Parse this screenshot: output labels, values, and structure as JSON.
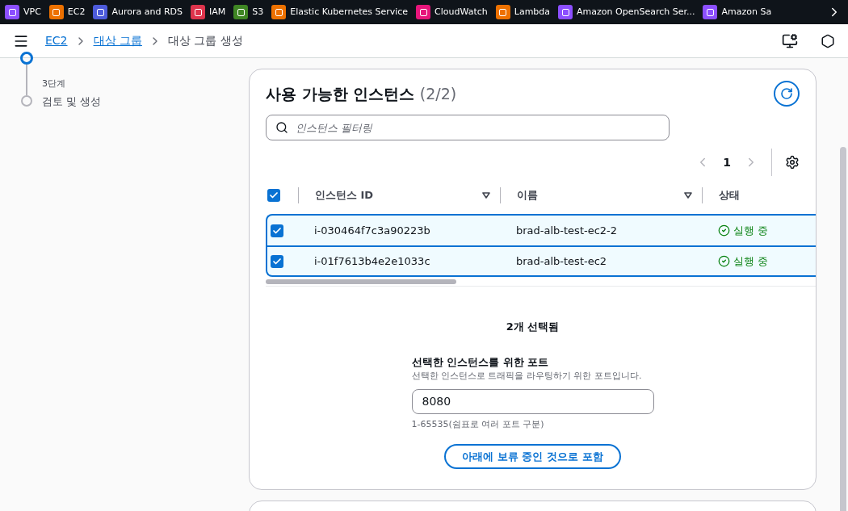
{
  "services": [
    {
      "label": "VPC",
      "color": "#8c4fff"
    },
    {
      "label": "EC2",
      "color": "#ed7100"
    },
    {
      "label": "Aurora and RDS",
      "color": "#4d5bdb"
    },
    {
      "label": "IAM",
      "color": "#dd344c"
    },
    {
      "label": "S3",
      "color": "#3f8624"
    },
    {
      "label": "Elastic Kubernetes Service",
      "color": "#ed7100"
    },
    {
      "label": "CloudWatch",
      "color": "#e7157b"
    },
    {
      "label": "Lambda",
      "color": "#ed7100"
    },
    {
      "label": "Amazon OpenSearch Ser...",
      "color": "#8c4fff"
    },
    {
      "label": "Amazon Sa",
      "color": "#8c4fff"
    }
  ],
  "breadcrumbs": [
    {
      "label": "EC2",
      "kind": "link"
    },
    {
      "label": "대상 그룹",
      "kind": "link"
    },
    {
      "label": "대상 그룹 생성",
      "kind": "current"
    }
  ],
  "steps": [
    {
      "step": "3단계",
      "label": "검토 및 생성",
      "selected": false
    }
  ],
  "panel": {
    "title": "사용 가능한 인스턴스",
    "count": "(2/2)",
    "search": {
      "placeholder": "인스턴스 필터링"
    },
    "page": "1",
    "columns": [
      "인스턴스 ID",
      "이름",
      "상태"
    ],
    "all_checked": true,
    "rows": [
      {
        "id": "i-030464f7c3a90223b",
        "name": "brad-alb-test-ec2-2",
        "status": "실행 중",
        "checked": true
      },
      {
        "id": "i-01f7613b4e2e1033c",
        "name": "brad-alb-test-ec2",
        "status": "실행 중",
        "checked": true
      }
    ],
    "selected_count": "2개 선택됨",
    "port_label": "선택한 인스턴스를 위한 포트",
    "port_description": "선택한 인스턴스로 트래픽을 라우팅하기 위한 포트입니다.",
    "port_value": "8080",
    "port_hint": "1-65535(쉼표로 여러 포트 구분)",
    "include_button": "아래에 보류 중인 것으로 포함"
  }
}
